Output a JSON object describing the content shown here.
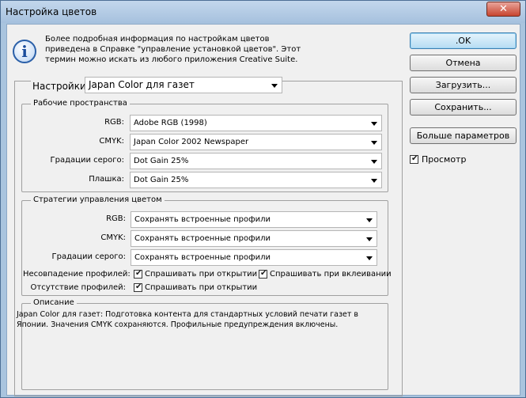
{
  "window": {
    "title": "Настройка цветов",
    "close_label": "✕"
  },
  "info": {
    "lines": [
      "Более подробная информация по настройкам цветов",
      "приведена в Справке \"управление установкой цветов\". Этот",
      "термин можно искать из любого приложения Creative Suite."
    ]
  },
  "settings": {
    "label": "Настройки:",
    "value": "Japan Color для газет"
  },
  "workspaces": {
    "title": "Рабочие пространства",
    "rows": [
      {
        "label": "RGB:",
        "value": "Adobe RGB (1998)"
      },
      {
        "label": "CMYK:",
        "value": "Japan Color 2002 Newspaper"
      },
      {
        "label": "Градации серого:",
        "value": "Dot Gain 25%"
      },
      {
        "label": "Плашка:",
        "value": "Dot Gain 25%"
      }
    ]
  },
  "policies": {
    "title": "Стратегии управления цветом",
    "rows": [
      {
        "label": "RGB:",
        "value": "Сохранять встроенные профили"
      },
      {
        "label": "CMYK:",
        "value": "Сохранять встроенные профили"
      },
      {
        "label": "Градации серого:",
        "value": "Сохранять встроенные профили"
      }
    ],
    "mismatch": {
      "label": "Несовпадение профилей:",
      "ask_open": "Спрашивать при открытии",
      "ask_paste": "Спрашивать при вклеивании",
      "ask_open_checked": true,
      "ask_paste_checked": true
    },
    "missing": {
      "label": "Отсутствие профилей:",
      "ask_open": "Спрашивать при открытии",
      "ask_open_checked": true
    }
  },
  "description": {
    "title": "Описание",
    "lines": [
      "Japan Color для газет:  Подготовка контента для стандартных условий печати газет в",
      "Японии. Значения CMYK сохраняются. Профильные предупреждения включены."
    ]
  },
  "buttons": {
    "ok": ".OK",
    "cancel": "Отмена",
    "load": "Загрузить...",
    "save": "Сохранить...",
    "more": "Больше параметров"
  },
  "preview": {
    "label": "Просмотр",
    "checked": true
  },
  "colors": {
    "title_bar": "#a9c4de",
    "dialog_bg": "#f0f0f0",
    "default_button": "#b6dcf3"
  }
}
